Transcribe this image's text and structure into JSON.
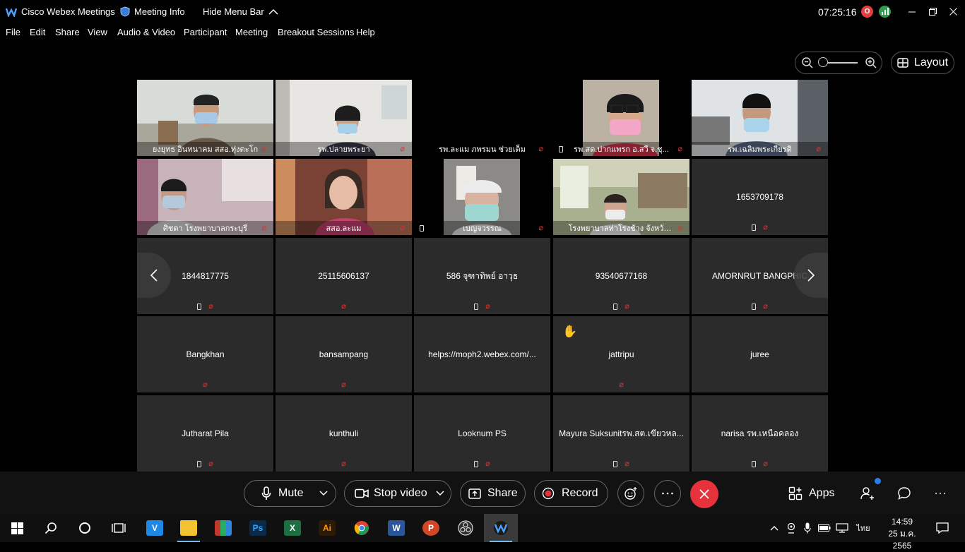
{
  "titlebar": {
    "app_name": "Cisco Webex Meetings",
    "meeting_info": "Meeting Info",
    "hide_menu": "Hide Menu Bar",
    "time": "07:25:16",
    "recording_badge": "O"
  },
  "menu": [
    "File",
    "Edit",
    "Share",
    "View",
    "Audio & Video",
    "Participant",
    "Meeting",
    "Breakout Sessions",
    "Help"
  ],
  "layout_label": "Layout",
  "grid": {
    "rows": [
      [
        {
          "type": "video",
          "scene": 1,
          "name": "ยงยุทธ อินทนาคม สสอ.ทุ่งตะโก",
          "mute": true,
          "phone": false
        },
        {
          "type": "video",
          "scene": 2,
          "name": "รพ.ปลายพระยา",
          "mute": true,
          "phone": false
        },
        {
          "type": "video",
          "scene": 0,
          "name": "รพ.ละแม ภพรมน ช่วยเต็ม",
          "mute": true,
          "phone": false
        },
        {
          "type": "video",
          "scene": 3,
          "name": "รพ.สต.ปากแพรก อ.สวี จ.ชุ...",
          "mute": true,
          "phone": true
        },
        {
          "type": "video",
          "scene": 4,
          "name": "รพ.เฉลิมพระเกียรติ",
          "mute": true,
          "phone": false
        }
      ],
      [
        {
          "type": "video",
          "scene": 5,
          "name": "ศิชดา โรงพยาบาลกระบุรี",
          "mute": true,
          "phone": false
        },
        {
          "type": "video",
          "scene": 6,
          "name": "สสอ.ละแม",
          "mute": true,
          "phone": false
        },
        {
          "type": "video",
          "scene": 7,
          "name": "เบญจวรรณ",
          "mute": true,
          "phone": true
        },
        {
          "type": "video",
          "scene": 8,
          "name": "โรงพยาบาลท่าโรงช้าง จังหวัดสุรา...",
          "mute": true,
          "phone": false
        },
        {
          "type": "name",
          "name": "1653709178",
          "mute": true,
          "phone": true
        }
      ],
      [
        {
          "type": "name",
          "name": "1844817775",
          "mute": true,
          "phone": true
        },
        {
          "type": "name",
          "name": "25115606137",
          "mute": true,
          "phone": false
        },
        {
          "type": "name",
          "name": "586 จุฑาทิพย์ อาวุธ",
          "mute": true,
          "phone": true
        },
        {
          "type": "name",
          "name": "93540677168",
          "mute": true,
          "phone": true
        },
        {
          "type": "name",
          "name": "AMORNRUT BANGPHIC",
          "mute": true,
          "phone": true
        }
      ],
      [
        {
          "type": "name",
          "name": "Bangkhan",
          "mute": true,
          "phone": false
        },
        {
          "type": "name",
          "name": "bansampang",
          "mute": true,
          "phone": false
        },
        {
          "type": "name",
          "name": "helps://moph2.webex.com/...",
          "mute": false,
          "phone": false
        },
        {
          "type": "name",
          "name": "jattripu",
          "mute": true,
          "phone": false
        },
        {
          "type": "name",
          "name": "juree",
          "mute": false,
          "phone": false
        }
      ],
      [
        {
          "type": "name",
          "name": "Jutharat Pila",
          "mute": true,
          "phone": true
        },
        {
          "type": "name",
          "name": "kunthuli",
          "mute": true,
          "phone": false
        },
        {
          "type": "name",
          "name": "Looknum PS",
          "mute": true,
          "phone": true
        },
        {
          "type": "name",
          "name": "Mayura Suksunitรพ.สต.เขียวหล...",
          "mute": true,
          "phone": true
        },
        {
          "type": "name",
          "name": "narisa รพ.เหนือคลอง",
          "mute": true,
          "phone": true
        }
      ]
    ]
  },
  "controls": {
    "mute": "Mute",
    "stop_video": "Stop video",
    "share": "Share",
    "record": "Record",
    "apps": "Apps"
  },
  "taskbar": {
    "time": "14:59",
    "date": "25 ม.ค. 2565",
    "lang": "ไทย"
  },
  "colors": {
    "leave": "#e5323d",
    "muted": "#e03131",
    "tile": "#2b2b2b"
  }
}
